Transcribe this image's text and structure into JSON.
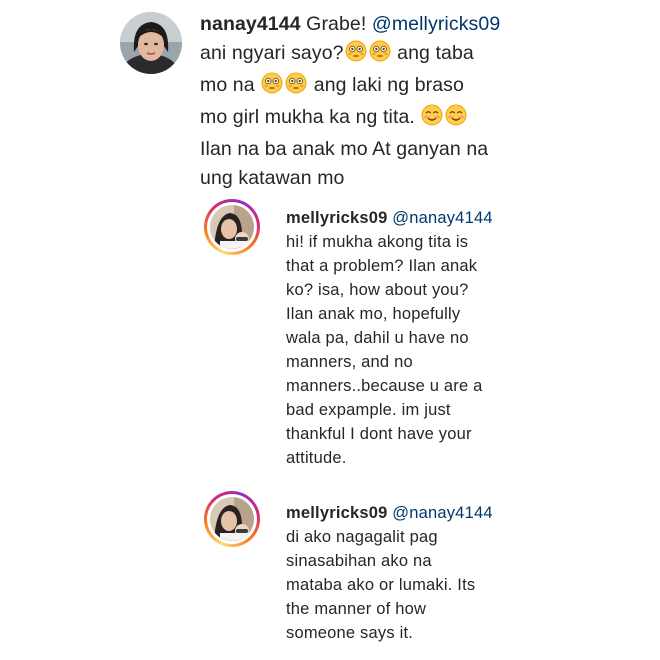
{
  "comment": {
    "username": "nanay4144",
    "text_before_mention": "Grabe!",
    "mention": "@mellyricks09",
    "line2": "ani ngyari sayo?",
    "line3a": "ang taba",
    "line3b": "mo na",
    "line3c": "ang laki ng braso",
    "line4": "mo girl mukha ka ng tita.",
    "line5": "Ilan na ba anak mo At ganyan na",
    "line6": "ung katawan mo"
  },
  "reply1": {
    "username": "mellyricks09",
    "mention": "@nanay4144",
    "lines": [
      "hi! if mukha akong tita is",
      "that a problem? Ilan anak",
      "ko? isa, how about you?",
      "Ilan anak mo, hopefully",
      "wala pa, dahil u have no",
      "manners, and no",
      "manners..because u are a",
      "bad expample. im just",
      "thankful I dont have your",
      "attitude."
    ]
  },
  "reply2": {
    "username": "mellyricks09",
    "mention": "@nanay4144",
    "lines": [
      "di ako nagagalit pag",
      "sinasabihan ako na",
      "mataba ako or lumaki. Its",
      "the manner of how",
      "someone says it."
    ]
  },
  "emojis": {
    "flushed": "flushed-face-icon",
    "blush": "smiling-face-with-smiling-eyes-icon"
  }
}
